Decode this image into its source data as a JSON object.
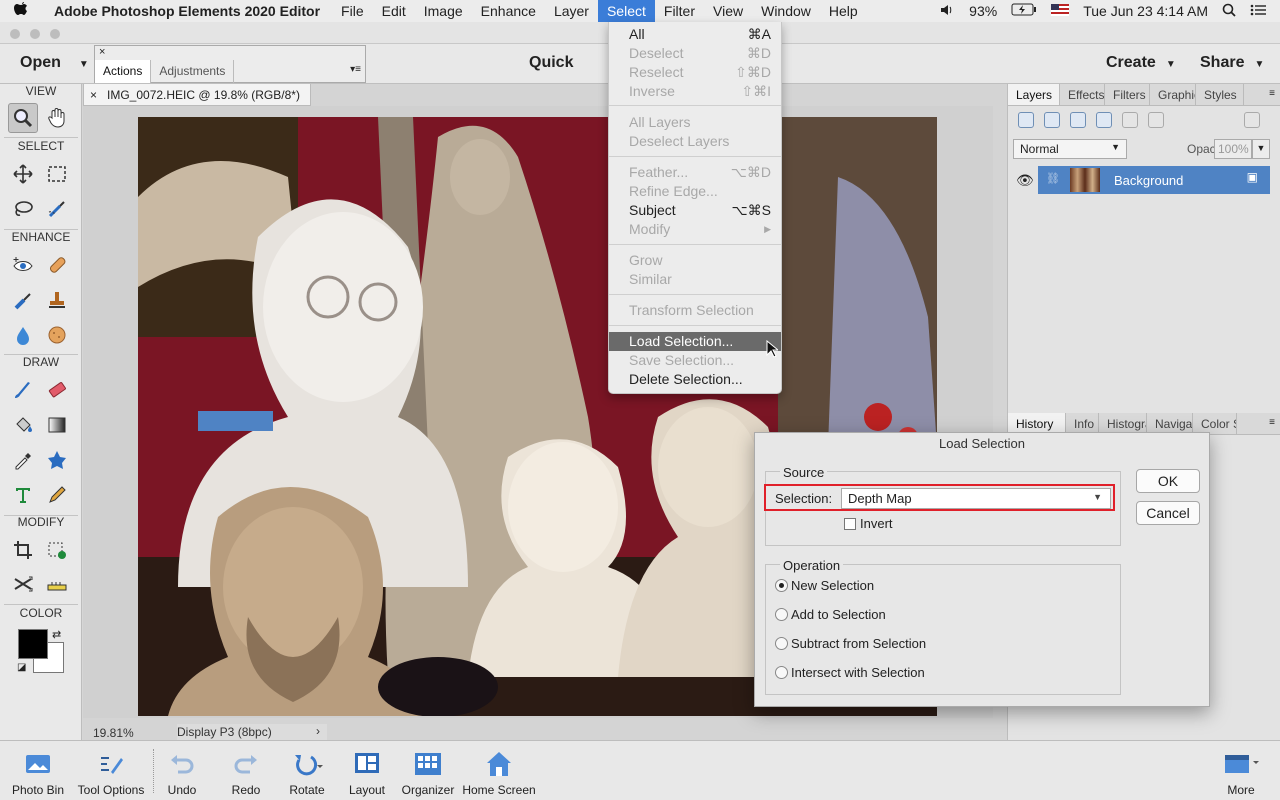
{
  "menubar": {
    "apple": "",
    "app_name": "Adobe Photoshop Elements 2020 Editor",
    "menus": [
      "File",
      "Edit",
      "Image",
      "Enhance",
      "Layer",
      "Select",
      "Filter",
      "View",
      "Window",
      "Help"
    ],
    "active_menu": "Select",
    "battery": "93%",
    "datetime": "Tue Jun 23  4:14 AM"
  },
  "modebar": {
    "open_label": "Open",
    "mode_label": "Quick",
    "create_label": "Create",
    "share_label": "Share"
  },
  "actions_panel": {
    "close": "×",
    "tabs": [
      "Actions",
      "Adjustments"
    ]
  },
  "toolbox": {
    "headers": [
      "VIEW",
      "SELECT",
      "ENHANCE",
      "DRAW",
      "MODIFY",
      "COLOR"
    ]
  },
  "document": {
    "tab_title": "IMG_0072.HEIC @ 19.8% (RGB/8*)",
    "zoom": "19.81%",
    "profile": "Display P3 (8bpc)"
  },
  "layers_panel": {
    "tabs": [
      "Layers",
      "Effects",
      "Filters",
      "Graphics",
      "Styles"
    ],
    "blend_mode": "Normal",
    "opacity_label": "Opacity:",
    "opacity_value": "100%",
    "layer_name": "Background"
  },
  "history_panel": {
    "tabs": [
      "History",
      "Info",
      "Histogram",
      "Navigator",
      "Color S"
    ]
  },
  "select_menu": {
    "items": [
      {
        "label": "All",
        "shortcut": "⌘A",
        "disabled": false
      },
      {
        "label": "Deselect",
        "shortcut": "⌘D",
        "disabled": true
      },
      {
        "label": "Reselect",
        "shortcut": "⇧⌘D",
        "disabled": true
      },
      {
        "label": "Inverse",
        "shortcut": "⇧⌘I",
        "disabled": true
      },
      {
        "label": "All Layers",
        "shortcut": "",
        "disabled": true
      },
      {
        "label": "Deselect Layers",
        "shortcut": "",
        "disabled": true
      },
      {
        "label": "Feather...",
        "shortcut": "⌥⌘D",
        "disabled": true
      },
      {
        "label": "Refine Edge...",
        "shortcut": "",
        "disabled": true
      },
      {
        "label": "Subject",
        "shortcut": "⌥⌘S",
        "disabled": false
      },
      {
        "label": "Modify",
        "shortcut": "▶",
        "disabled": true
      },
      {
        "label": "Grow",
        "shortcut": "",
        "disabled": true
      },
      {
        "label": "Similar",
        "shortcut": "",
        "disabled": true
      },
      {
        "label": "Transform Selection",
        "shortcut": "",
        "disabled": true
      },
      {
        "label": "Load Selection...",
        "shortcut": "",
        "disabled": false,
        "highlighted": true
      },
      {
        "label": "Save Selection...",
        "shortcut": "",
        "disabled": true
      },
      {
        "label": "Delete Selection...",
        "shortcut": "",
        "disabled": false
      }
    ]
  },
  "dialog": {
    "title": "Load Selection",
    "source_title": "Source",
    "selection_label": "Selection:",
    "selection_value": "Depth Map",
    "invert_label": "Invert",
    "invert_checked": false,
    "operation_title": "Operation",
    "operations": [
      {
        "label": "New Selection",
        "selected": true
      },
      {
        "label": "Add to Selection",
        "selected": false
      },
      {
        "label": "Subtract from Selection",
        "selected": false
      },
      {
        "label": "Intersect with Selection",
        "selected": false
      }
    ],
    "ok_label": "OK",
    "cancel_label": "Cancel"
  },
  "bottombar": {
    "photo_bin": "Photo Bin",
    "tool_options": "Tool Options",
    "undo": "Undo",
    "redo": "Redo",
    "rotate": "Rotate",
    "layout": "Layout",
    "organizer": "Organizer",
    "home_screen": "Home Screen",
    "more": "More"
  },
  "colors": {
    "accent": "#3b7dd8",
    "layer_selected": "#4f83c4",
    "highlight_border": "#e0202a"
  }
}
